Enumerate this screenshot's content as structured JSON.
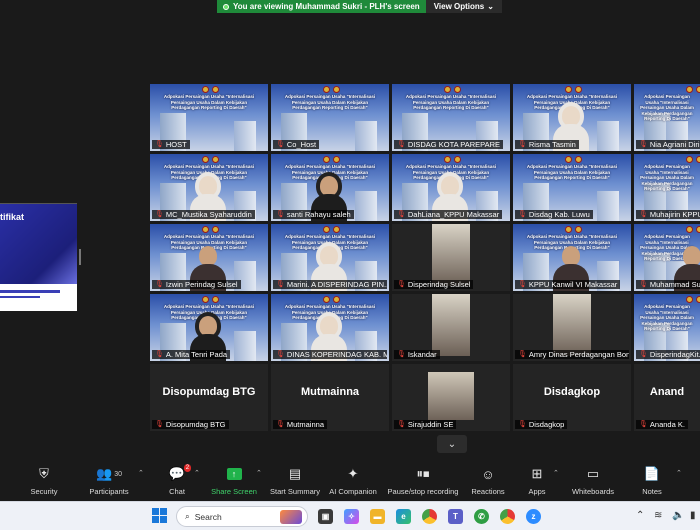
{
  "banner": {
    "message": "You are viewing Muhammad Sukri - PLH's screen",
    "view_options": "View Options",
    "caret": "⌄"
  },
  "shared_screen": {
    "visible_word": "tifikat"
  },
  "slide_title": "Adpokasi Persaingan Usaha \"Internalisasi Persaingan Usaha Dalam Kebijakan Perdagangan Reporting Di Daerah\"",
  "participants": [
    {
      "name": "HOST",
      "video": "slide"
    },
    {
      "name": "Co_Host",
      "video": "slide"
    },
    {
      "name": "DISDAG KOTA PAREPARE",
      "video": "slide"
    },
    {
      "name": "Risma Tasmin",
      "video": "slide-person-hijab"
    },
    {
      "name": "Nia Agriani Diri...",
      "video": "slide"
    },
    {
      "name": "MC_Mustika Syaharuddin",
      "video": "slide-person-hijab"
    },
    {
      "name": "santi Rahayu saleh",
      "video": "slide-person-dark"
    },
    {
      "name": "DahLiana_KPPU Makassar",
      "video": "slide-person-hijab",
      "active": true
    },
    {
      "name": "Disdag Kab. Luwu",
      "video": "slide"
    },
    {
      "name": "Muhajirin KPPU...",
      "video": "slide"
    },
    {
      "name": "Izwin Perindag Sulsel",
      "video": "slide-person"
    },
    {
      "name": "Marini. A DISPERINDAG PIN...",
      "video": "slide-person-hijab"
    },
    {
      "name": "Disperindag Sulsel",
      "video": "camera"
    },
    {
      "name": "KPPU Kanwil VI Makassar",
      "video": "slide-person"
    },
    {
      "name": "Muhammad Su...",
      "video": "slide-person"
    },
    {
      "name": "A. Mita Tenri Pada",
      "video": "slide-person-dark"
    },
    {
      "name": "DINAS KOPERINDAG KAB. MAR...",
      "video": "slide-person-hijab"
    },
    {
      "name": "Iskandar",
      "video": "camera"
    },
    {
      "name": "Amry  Dinas Perdagangan Bone",
      "video": "camera"
    },
    {
      "name": "DisperindagKit...",
      "video": "slide"
    },
    {
      "name": "Disopumdag BTG",
      "video": "name",
      "display": "Disopumdag BTG"
    },
    {
      "name": "Mutmainna",
      "video": "name",
      "display": "Mutmainna"
    },
    {
      "name": "Sirajuddin SE",
      "video": "camera-photo"
    },
    {
      "name": "Disdagkop",
      "video": "name",
      "display": "Disdagkop"
    },
    {
      "name": "Ananda K.",
      "video": "name",
      "display": "Anand"
    }
  ],
  "toolbar": {
    "security": "Security",
    "participants": "Participants",
    "participants_count": "30",
    "chat": "Chat",
    "chat_badge": "2",
    "share_screen": "Share Screen",
    "start_summary": "Start Summary",
    "ai_companion": "AI Companion",
    "pause_recording": "Pause/stop recording",
    "reactions": "Reactions",
    "apps": "Apps",
    "whiteboards": "Whiteboards",
    "notes": "Notes"
  },
  "taskbar": {
    "search_placeholder": "Search"
  },
  "colors": {
    "banner_green": "#1f8a3a",
    "active_speaker": "#a2d61c",
    "share_green": "#20b34b",
    "muted_red": "#e5433a"
  }
}
